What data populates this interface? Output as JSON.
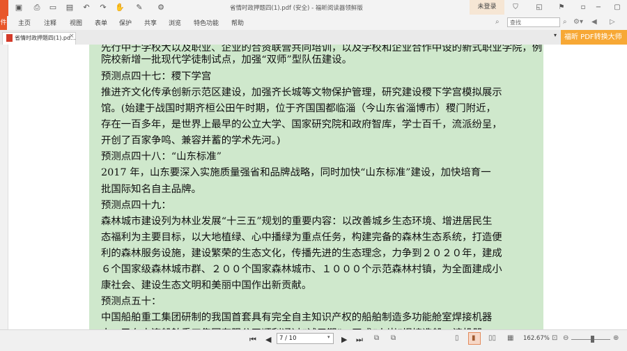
{
  "titlebar": {
    "title": "省情时政押题四(1).pdf (安全) - 福昕阅读器领鲜版",
    "login_label": "未登录",
    "quick_icons": [
      "save-icon",
      "print-icon",
      "fullscreen-icon",
      "open-icon",
      "undo-icon",
      "redo-icon",
      "hand-icon",
      "select-icon",
      "share-icon"
    ],
    "window_icons": [
      "store-icon",
      "skin-icon",
      "minimize-icon",
      "restore-icon",
      "close-icon"
    ]
  },
  "menubar": {
    "file_label": "件",
    "items": [
      "主页",
      "注释",
      "视图",
      "表单",
      "保护",
      "共享",
      "浏览",
      "特色功能",
      "帮助"
    ],
    "search_placeholder": "查找"
  },
  "tabs": {
    "doc_tab_label": "省情时政押题四(1).pd...",
    "promo_label": "福昕 PDF转换大师"
  },
  "document": {
    "lines": [
      "院校新增一批现代学徒制试点，加强“双师”型队伍建设。",
      "预测点四十七：稷下学宫",
      "推进齐文化传承创新示范区建设，加强齐长城等文物保护管理，研究建设稷下学宫模拟展示",
      "馆。(始建于战国时期齐桓公田午时期，位于齐国国都临淄（今山东省淄博市）稷门附近，",
      "存在一百多年，是世界上最早的公立大学、国家研究院和政府智库，学士百千，流派纷呈，",
      "开创了百家争鸣、兼容并蓄的学术先河。)",
      "预测点四十八：“山东标准”",
      "2017 年，山东要深入实施质量强省和品牌战略，同时加快“山东标准”建设，加快培育一",
      "批国际知名自主品牌。",
      "预测点四十九：",
      "森林城市建设列为林业发展“十三五”规划的重要内容：以改善城乡生态环境、增进居民生",
      "态福利为主要目标，以大地植绿、心中播绿为重点任务，构建完备的森林生态系统，打造便",
      "利的森林服务设施，建设繁荣的生态文化，传播先进的生态理念，力争到２０２０年，建成",
      "６个国家级森林城市群、２００个国家森林城市、１０００个示范森林村镇，为全面建成小",
      "康社会、建设生态文明和美丽中国作出新贡献。",
      "预测点五十：",
      "中国船舶重工集团研制的我国首套具有完全自主知识产权的船舶制造多功能舱室焊接机器"
    ]
  },
  "bottombar": {
    "page_value": "7 / 10",
    "zoom_label": "162.67%"
  },
  "colors": {
    "page_bg": "#cfe8cc",
    "accent_orange": "#e8572a",
    "promo_bg": "#f7a835"
  }
}
